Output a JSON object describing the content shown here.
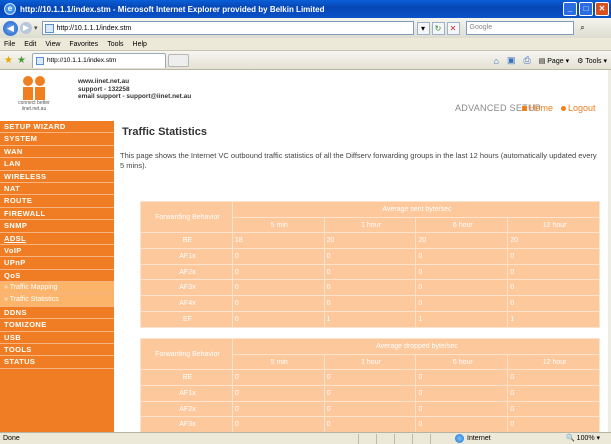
{
  "window": {
    "title": "http://10.1.1.1/index.stm - Microsoft Internet Explorer provided by Belkin Limited",
    "minimize": "_",
    "maximize": "□",
    "close": "✕"
  },
  "addressbar": {
    "url": "http://10.1.1.1/index.stm",
    "search_placeholder": "Google"
  },
  "menu": [
    "File",
    "Edit",
    "View",
    "Favorites",
    "Tools",
    "Help"
  ],
  "tabs": [
    {
      "label": "http://10.1.1.1/index.stm"
    }
  ],
  "commandbar": {
    "page": "Page",
    "tools": "Tools"
  },
  "header": {
    "logo_caption_1": "connect better",
    "logo_caption_2": "iinet.net.au",
    "contact_1": "www.iinet.net.au",
    "contact_2": "support - 132258",
    "contact_3": "email support - support@iinet.net.au",
    "mode": "ADVANCED SETUP",
    "home": "Home",
    "logout": "Logout"
  },
  "sidebar": {
    "items": [
      {
        "label": "SETUP WIZARD"
      },
      {
        "label": "SYSTEM"
      },
      {
        "label": "WAN"
      },
      {
        "label": "LAN"
      },
      {
        "label": "WIRELESS"
      },
      {
        "label": "NAT"
      },
      {
        "label": "ROUTE"
      },
      {
        "label": "FIREWALL"
      },
      {
        "label": "SNMP"
      },
      {
        "label": "ADSL"
      },
      {
        "label": "VoIP"
      },
      {
        "label": "UPnP"
      },
      {
        "label": "QoS"
      },
      {
        "label": "» Traffic Mapping"
      },
      {
        "label": "» Traffic Statistics"
      },
      {
        "label": "DDNS"
      },
      {
        "label": "TOMIZONE"
      },
      {
        "label": "USB"
      },
      {
        "label": "TOOLS"
      },
      {
        "label": "STATUS"
      }
    ]
  },
  "main": {
    "title": "Traffic Statistics",
    "description": "This page shows the Internet VC outbound traffic statistics of all the Diffserv forwarding groups in the last 12 hours (automatically updated every 5 mins).",
    "table1": {
      "row_header": "Forwarding Behavior",
      "group_header": "Average sent byte/sec",
      "columns": [
        "5 min",
        "1 hour",
        "6 hour",
        "12 hour"
      ],
      "rows": [
        {
          "label": "BE",
          "values": [
            "18",
            "20",
            "20",
            "20"
          ]
        },
        {
          "label": "AF1x",
          "values": [
            "0",
            "0",
            "0",
            "0"
          ]
        },
        {
          "label": "AF2x",
          "values": [
            "0",
            "0",
            "0",
            "0"
          ]
        },
        {
          "label": "AF3x",
          "values": [
            "0",
            "0",
            "0",
            "0"
          ]
        },
        {
          "label": "AF4x",
          "values": [
            "0",
            "0",
            "0",
            "0"
          ]
        },
        {
          "label": "EF",
          "values": [
            "0",
            "1",
            "1",
            "1"
          ]
        }
      ]
    },
    "table2": {
      "row_header": "Forwarding Behavior",
      "group_header": "Average dropped byte/sec",
      "columns": [
        "5 min",
        "1 hour",
        "6 hour",
        "12 hour"
      ],
      "rows": [
        {
          "label": "BE",
          "values": [
            "0",
            "0",
            "0",
            "0"
          ]
        },
        {
          "label": "AF1x",
          "values": [
            "0",
            "0",
            "0",
            "0"
          ]
        },
        {
          "label": "AF2x",
          "values": [
            "0",
            "0",
            "0",
            "0"
          ]
        },
        {
          "label": "AF3x",
          "values": [
            "0",
            "0",
            "0",
            "0"
          ]
        }
      ]
    }
  },
  "statusbar": {
    "status": "Done",
    "zone": "Internet",
    "zoom": "100%"
  },
  "colors": {
    "accent": "#f07d23",
    "table_cell": "#fcc89c",
    "submenu": "#fcb46b"
  }
}
